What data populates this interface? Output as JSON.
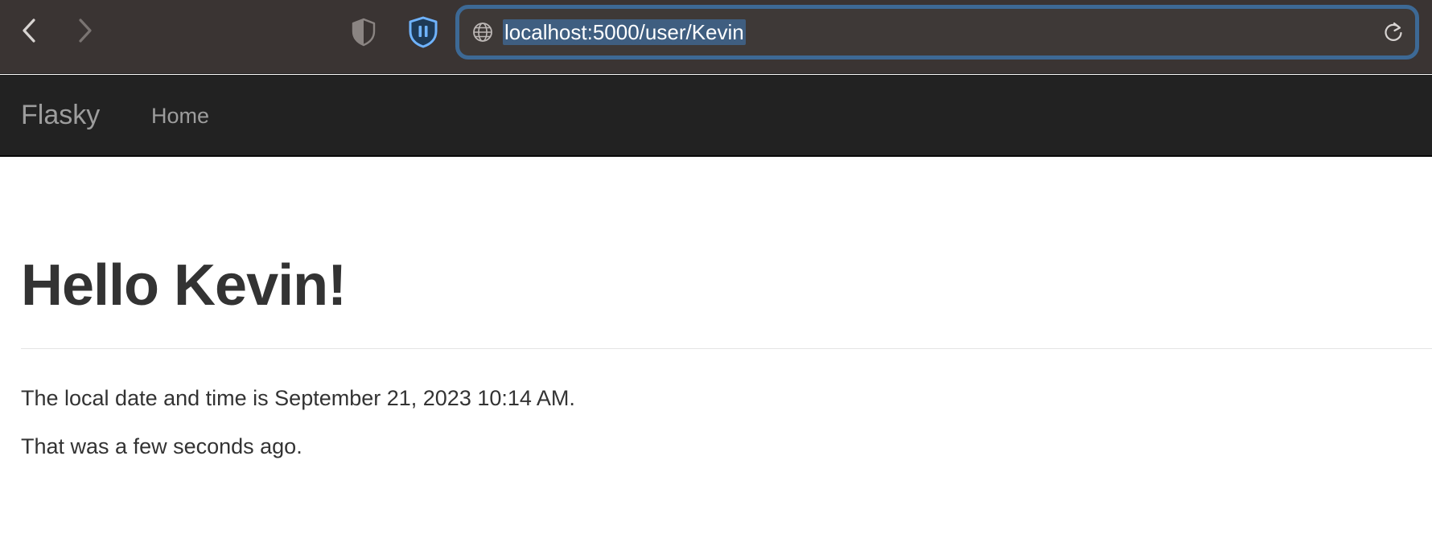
{
  "browser": {
    "url": "localhost:5000/user/Kevin",
    "icons": {
      "back": "chevron-left-icon",
      "forward": "chevron-right-icon",
      "privacy": "half-shield-icon",
      "extension": "pause-shield-icon",
      "site": "globe-icon",
      "reload": "reload-icon"
    },
    "colors": {
      "toolbar_bg": "#3a3433",
      "url_focus_ring": "#3d6995",
      "url_selection": "#3f5e80",
      "extension_accent": "#6fb3ff"
    }
  },
  "navbar": {
    "brand": "Flasky",
    "items": [
      {
        "label": "Home"
      }
    ],
    "colors": {
      "bg": "#222222",
      "text": "#9d9d9d"
    }
  },
  "content": {
    "heading": "Hello Kevin!",
    "datetime_text": "The local date and time is September 21, 2023 10:14 AM.",
    "relative_text": "That was a few seconds ago."
  }
}
